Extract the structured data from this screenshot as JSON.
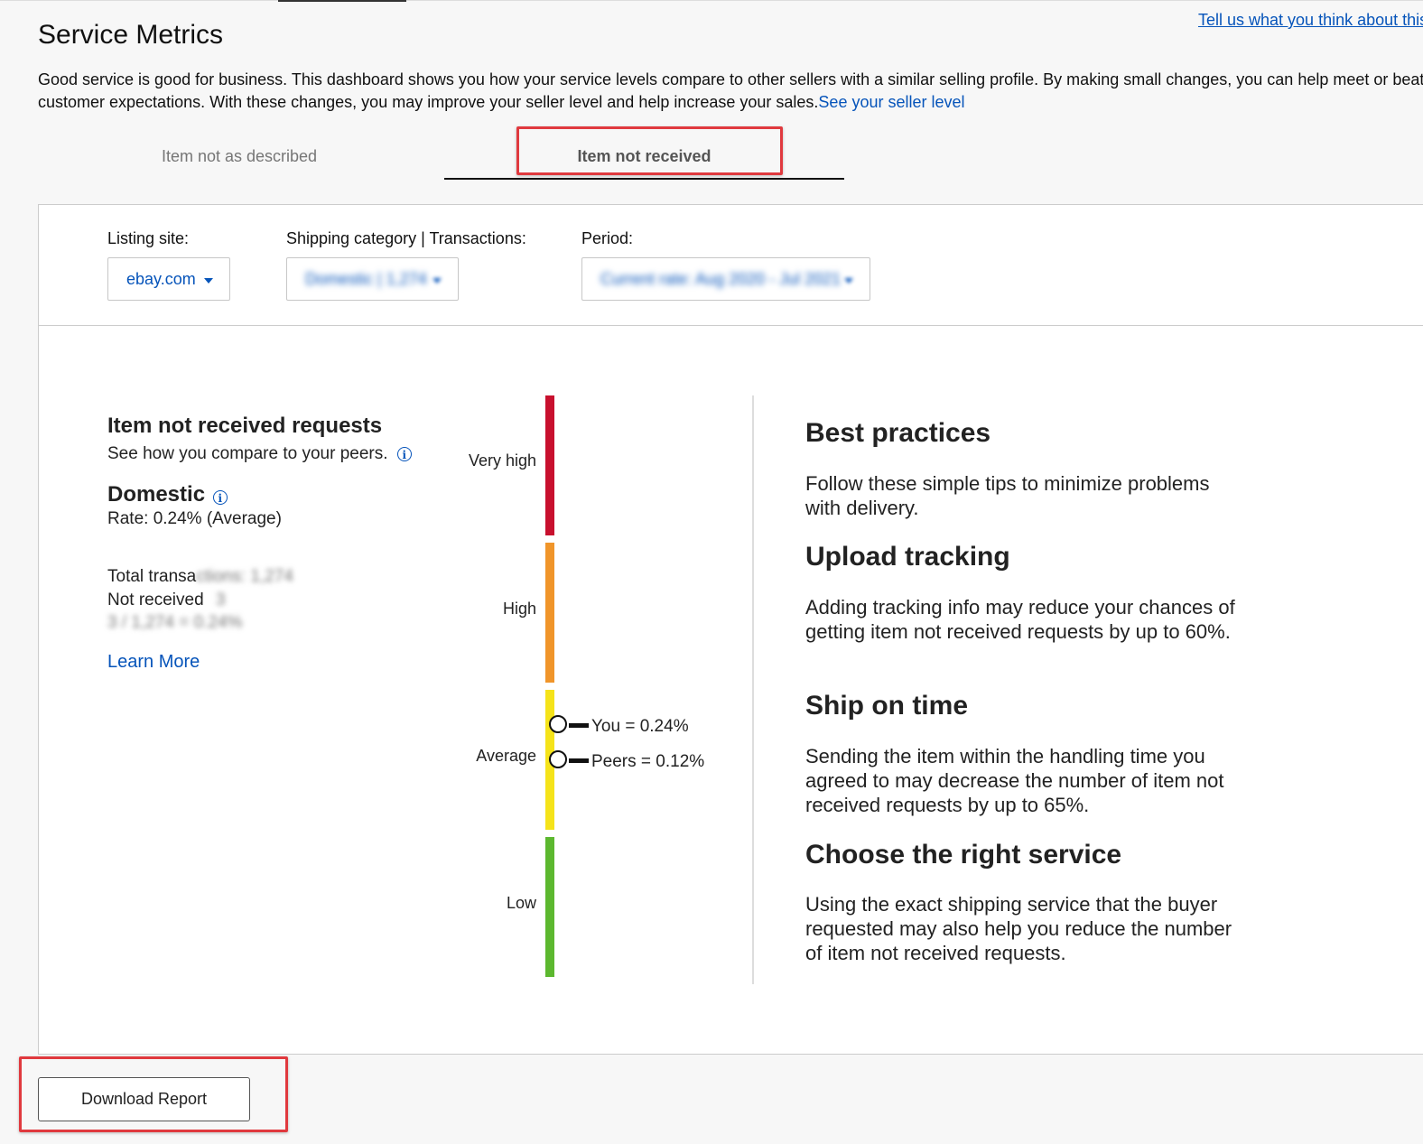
{
  "header": {
    "title": "Service Metrics",
    "feedback_link": "Tell us what you think about this",
    "intro_text": "Good service is good for business. This dashboard shows you how your service levels compare to other sellers with a similar selling profile. By making small changes, you can help meet or beat customer expectations. With these changes, you may improve your seller level and help increase your sales.",
    "seller_level_link": "See your seller level"
  },
  "tabs": [
    {
      "label": "Item not as described",
      "active": false
    },
    {
      "label": "Item not received",
      "active": true
    }
  ],
  "filters": {
    "listing_site": {
      "label": "Listing site:",
      "value": "ebay.com"
    },
    "shipping_category": {
      "label": "Shipping category | Transactions:",
      "value": "Domestic | 1,274"
    },
    "period": {
      "label": "Period:",
      "value": "Current rate: Aug 2020 - Jul 2021"
    }
  },
  "summary": {
    "title": "Item not received requests",
    "subtitle": "See how you compare to your peers.",
    "region": "Domestic",
    "rate": "Rate: 0.24% (Average)",
    "total_transactions_label": "Total transa",
    "total_transactions_value": "ctions: 1,274",
    "not_received_label": "Not received",
    "not_received_value": "3",
    "calculation": "3 / 1,274 = 0.24%",
    "learn_more": "Learn More"
  },
  "scale": {
    "levels": [
      {
        "label": "Very high",
        "color": "#c8102e"
      },
      {
        "label": "High",
        "color": "#f0952a"
      },
      {
        "label": "Average",
        "color": "#f5e31a"
      },
      {
        "label": "Low",
        "color": "#5cb82f"
      }
    ],
    "you_label": "You = 0.24%",
    "peers_label": "Peers = 0.12%"
  },
  "best_practices": {
    "title": "Best practices",
    "intro": "Follow these simple tips to minimize problems with delivery.",
    "tips": [
      {
        "title": "Upload tracking",
        "text": "Adding tracking info may reduce your chances of getting item not received requests by up to 60%."
      },
      {
        "title": "Ship on time",
        "text": "Sending the item within the handling time you agreed to may decrease the number of item not received requests by up to 65%."
      },
      {
        "title": "Choose the right service",
        "text": "Using the exact shipping service that the buyer requested may also help you reduce the number of item not received requests."
      }
    ]
  },
  "footer": {
    "download_label": "Download Report"
  },
  "colors": {
    "link": "#0654ba",
    "highlight": "#e0393e"
  }
}
